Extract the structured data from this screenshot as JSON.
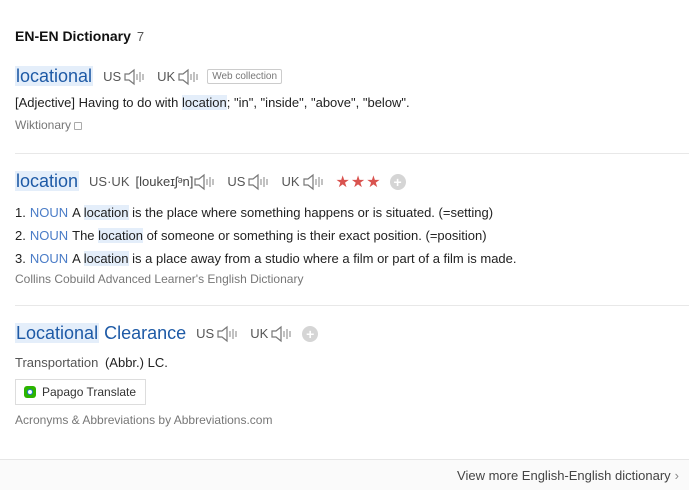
{
  "header": {
    "title": "EN-EN Dictionary",
    "count": "7"
  },
  "entries": [
    {
      "word": "locational",
      "pron": [
        {
          "label": "US"
        },
        {
          "label": "UK"
        }
      ],
      "tag": "Web collection",
      "definition": {
        "pos": "[Adjective]",
        "before": "Having to do with ",
        "highlight": "location",
        "after": "; \"in\", \"inside\", \"above\", \"below\"."
      },
      "source": "Wiktionary"
    },
    {
      "word": "location",
      "pron_combined": "US·UK",
      "ipa": "[loukeɪʃᵊn]",
      "pron": [
        {
          "label": "US"
        },
        {
          "label": "UK"
        }
      ],
      "stars": "★★★",
      "rating": 3,
      "senses": [
        {
          "num": "1.",
          "pos": "NOUN",
          "before": "A ",
          "highlight": "location",
          "after": " is the place where something happens or is situated. (=setting)"
        },
        {
          "num": "2.",
          "pos": "NOUN",
          "before": "The ",
          "highlight": "location",
          "after": " of someone or something is their exact position. (=position)"
        },
        {
          "num": "3.",
          "pos": "NOUN",
          "before": "A ",
          "highlight": "location",
          "after": " is a place away from a studio where a film or part of a film is made."
        }
      ],
      "source": "Collins Cobuild Advanced Learner's English Dictionary"
    },
    {
      "word_highlight": "Locational",
      "word_rest": " Clearance",
      "pron": [
        {
          "label": "US"
        },
        {
          "label": "UK"
        }
      ],
      "category": "Transportation",
      "abbr": "(Abbr.) LC.",
      "translate_label": "Papago Translate",
      "source": "Acronyms & Abbreviations by Abbreviations.com"
    }
  ],
  "footer": {
    "more_label": "View more English-English dictionary",
    "chevron": "›"
  },
  "icons": {
    "speaker": "speaker-icon",
    "add": "plus-icon",
    "external": "box-icon",
    "papago": "papago-logo-icon"
  },
  "colors": {
    "link": "#1e5aa6",
    "highlight": "#e4eefa",
    "star": "#d9534f",
    "pos": "#4a7cc7"
  }
}
